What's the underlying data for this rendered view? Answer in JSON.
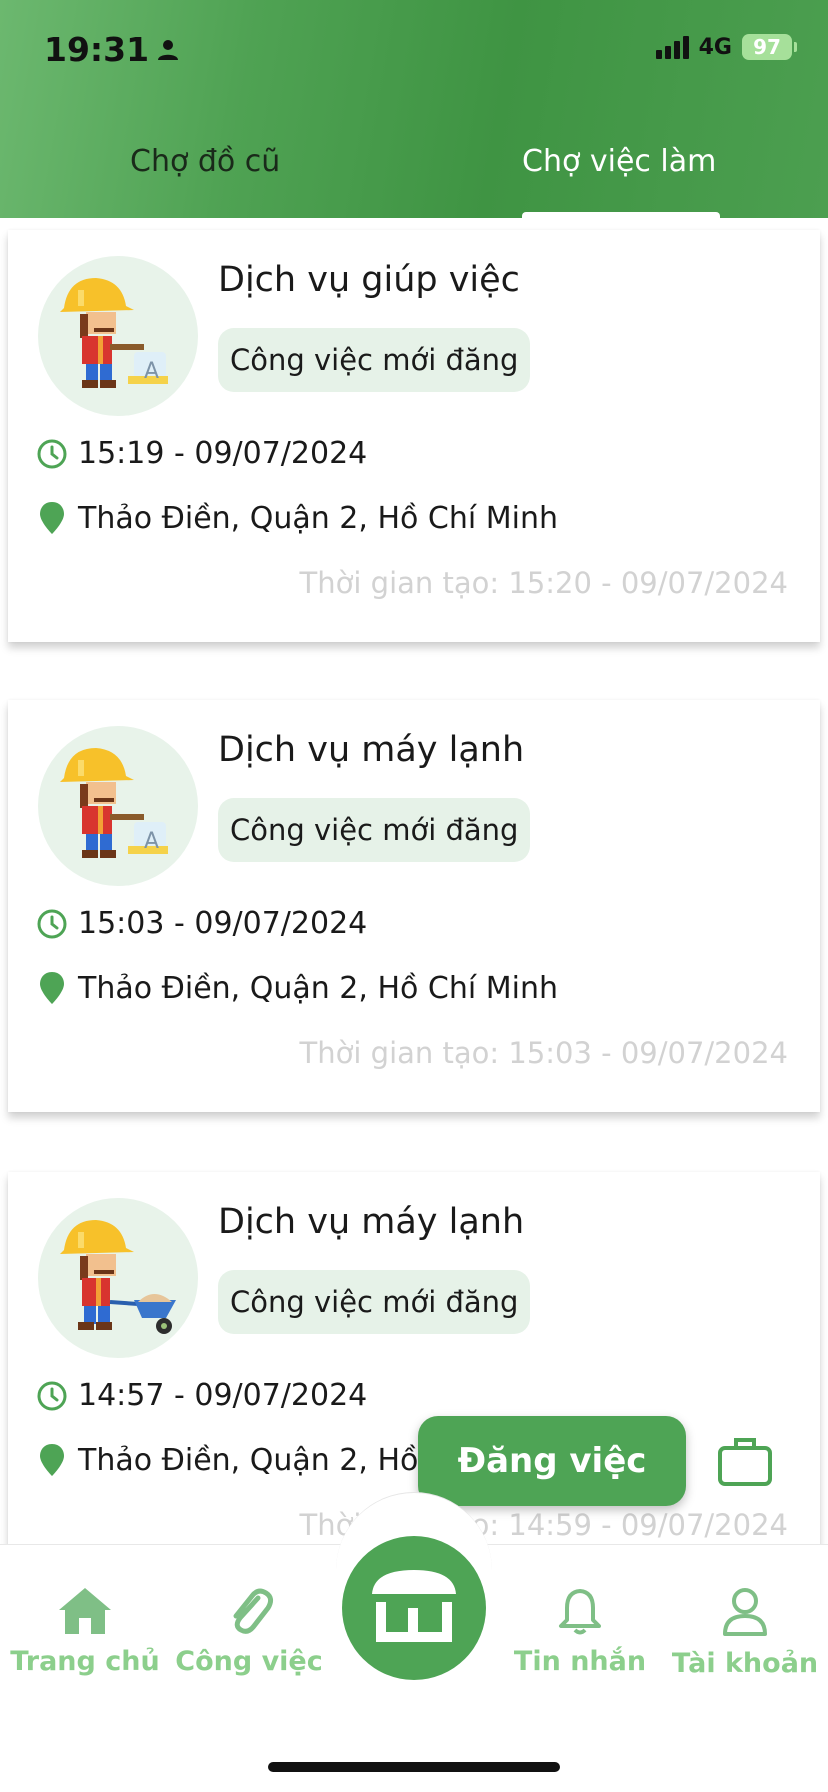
{
  "status_bar": {
    "time": "19:31",
    "network": "4G",
    "battery": "97"
  },
  "tabs": [
    {
      "label": "Chợ đồ cũ",
      "active": false
    },
    {
      "label": "Chợ việc làm",
      "active": true
    }
  ],
  "jobs": [
    {
      "title": "Dịch vụ giúp việc",
      "badge": "Công việc mới đăng",
      "time": "15:19 - 09/07/2024",
      "location": "Thảo Điền, Quận 2, Hồ Chí Minh",
      "created": "Thời gian tạo: 15:20 - 09/07/2024"
    },
    {
      "title": "Dịch vụ máy lạnh",
      "badge": "Công việc mới đăng",
      "time": "15:03 - 09/07/2024",
      "location": "Thảo Điền, Quận 2, Hồ Chí Minh",
      "created": "Thời gian tạo: 15:03 - 09/07/2024"
    },
    {
      "title": "Dịch vụ máy lạnh",
      "badge": "Công việc mới đăng",
      "time": "14:57 - 09/07/2024",
      "location": "Thảo Điền, Quận 2, Hồ Chí Minh",
      "created": "Thời gian tạo: 14:59 - 09/07/2024"
    }
  ],
  "post_button": {
    "label": "Đăng việc"
  },
  "bottom_nav": [
    {
      "label": "Trang chủ",
      "icon": "home-icon"
    },
    {
      "label": "Công việc",
      "icon": "paperclip-icon"
    },
    {
      "label": "",
      "icon": "store-icon"
    },
    {
      "label": "Tin nhắn",
      "icon": "bell-icon"
    },
    {
      "label": "Tài khoản",
      "icon": "user-icon"
    }
  ],
  "colors": {
    "primary": "#4ea455",
    "nav_label": "#8ccf8c",
    "badge_bg": "#e6f2e8",
    "created_text": "#d2d2d2"
  }
}
